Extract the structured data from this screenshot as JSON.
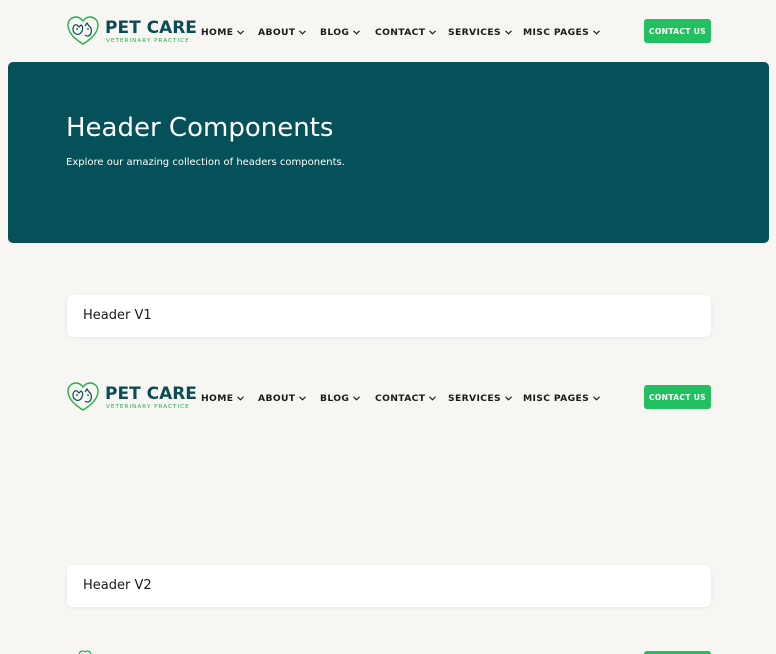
{
  "brand": {
    "name": "PET CARE",
    "tagline": "VETERINARY PRACTICE",
    "primary_color": "#0b4d55",
    "accent_color": "#23c061"
  },
  "nav": {
    "items": [
      {
        "label": "HOME"
      },
      {
        "label": "ABOUT"
      },
      {
        "label": "BLOG"
      },
      {
        "label": "CONTACT"
      },
      {
        "label": "SERVICES"
      },
      {
        "label": "MISC PAGES"
      }
    ],
    "cta_label": "CONTACT US"
  },
  "hero": {
    "title": "Header Components",
    "subtitle": "Explore our amazing collection of headers components.",
    "background": "#04515a"
  },
  "sections": [
    {
      "title": "Header V1"
    },
    {
      "title": "Header V2"
    }
  ]
}
